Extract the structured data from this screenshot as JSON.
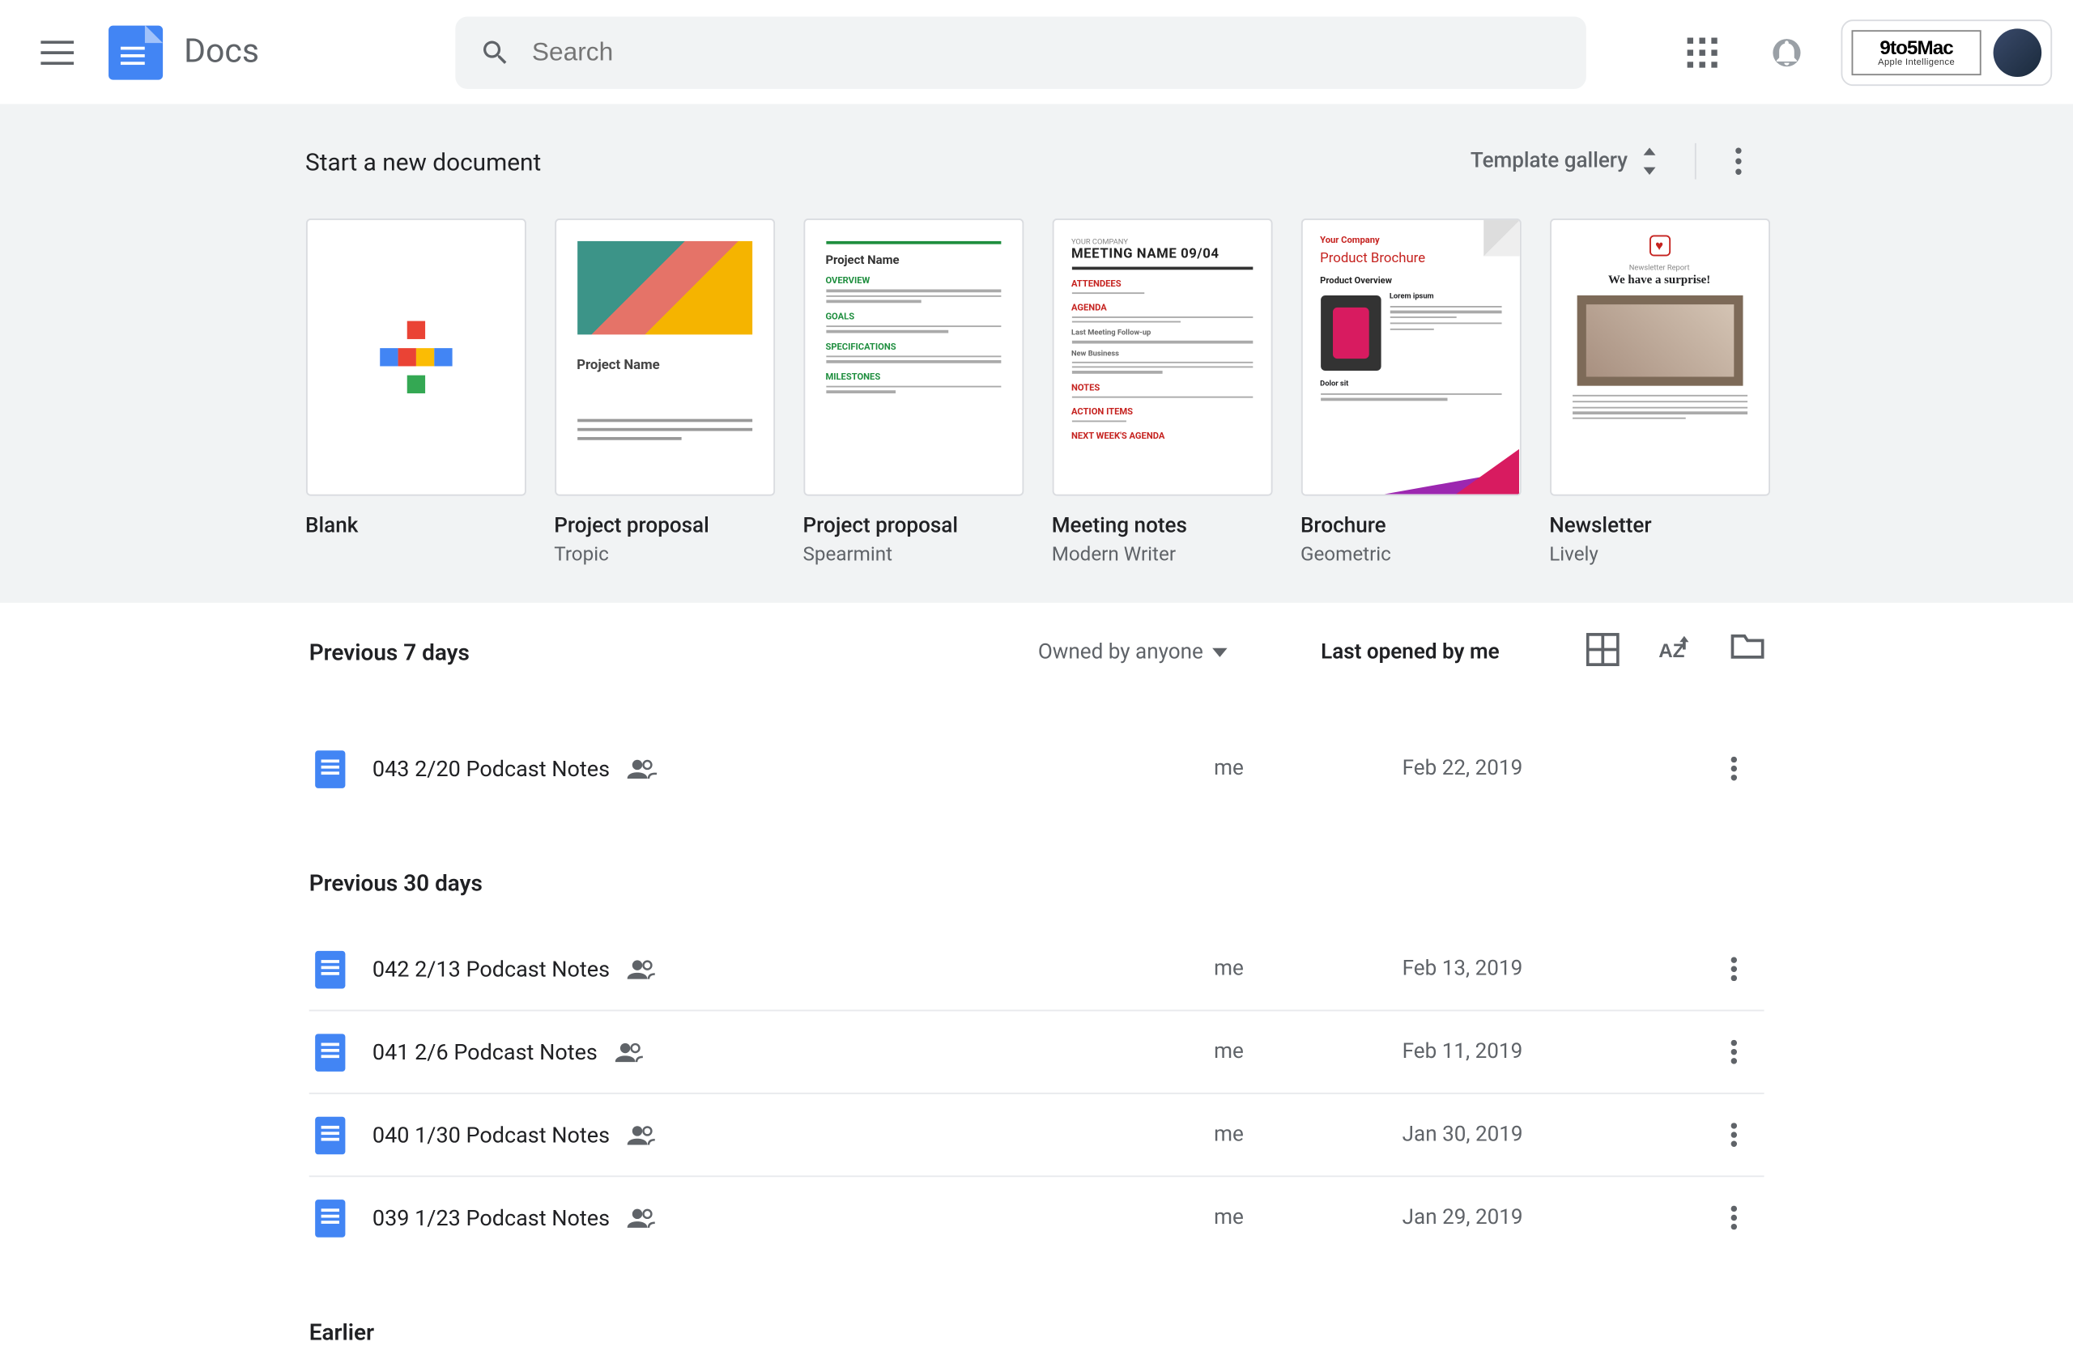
{
  "header": {
    "app_title": "Docs",
    "search_placeholder": "Search",
    "account_label": "9to5Mac",
    "account_sub": "Apple Intelligence"
  },
  "template_strip": {
    "heading": "Start a new document",
    "gallery_label": "Template gallery",
    "templates": [
      {
        "title": "Blank",
        "subtitle": ""
      },
      {
        "title": "Project proposal",
        "subtitle": "Tropic"
      },
      {
        "title": "Project proposal",
        "subtitle": "Spearmint"
      },
      {
        "title": "Meeting notes",
        "subtitle": "Modern Writer"
      },
      {
        "title": "Brochure",
        "subtitle": "Geometric"
      },
      {
        "title": "Newsletter",
        "subtitle": "Lively"
      }
    ],
    "t2_project_label": "Project Name",
    "t3_project_label": "Project Name",
    "t4_meeting_label": "MEETING NAME 09/04",
    "t5_company": "Your Company",
    "t5_brochure": "Product Brochure",
    "t5_overview": "Product Overview",
    "t6_surprise": "We have a surprise!"
  },
  "list": {
    "owned_by": "Owned by anyone",
    "sort_label": "Last opened by me",
    "groups": [
      {
        "heading": "Previous 7 days",
        "rows": [
          {
            "name": "043 2/20 Podcast Notes",
            "owner": "me",
            "date": "Feb 22, 2019",
            "shared": true
          }
        ]
      },
      {
        "heading": "Previous 30 days",
        "rows": [
          {
            "name": "042 2/13 Podcast Notes",
            "owner": "me",
            "date": "Feb 13, 2019",
            "shared": true
          },
          {
            "name": "041 2/6 Podcast Notes",
            "owner": "me",
            "date": "Feb 11, 2019",
            "shared": true
          },
          {
            "name": "040 1/30 Podcast Notes",
            "owner": "me",
            "date": "Jan 30, 2019",
            "shared": true
          },
          {
            "name": "039 1/23 Podcast Notes",
            "owner": "me",
            "date": "Jan 29, 2019",
            "shared": true
          }
        ]
      },
      {
        "heading": "Earlier",
        "rows": []
      }
    ]
  }
}
